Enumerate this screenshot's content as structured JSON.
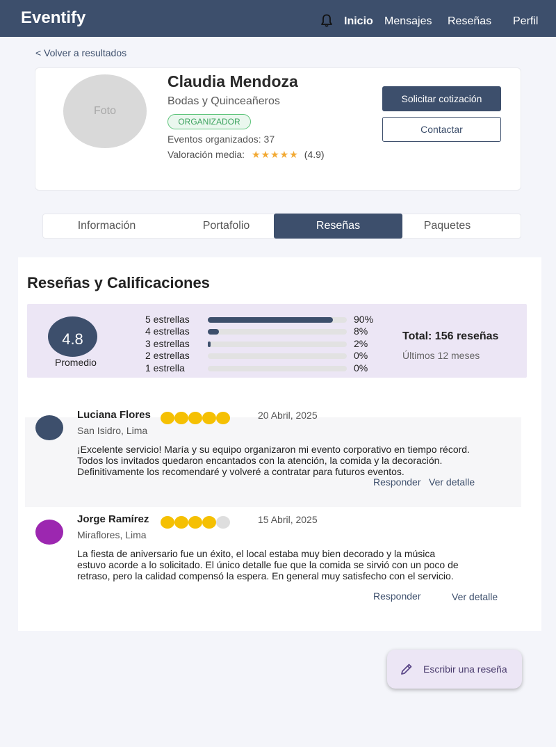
{
  "header": {
    "brand": "Eventify",
    "nav": [
      "Inicio",
      "Mensajes",
      "Reseñas",
      "Perfil"
    ]
  },
  "back_link": "< Volver a resultados",
  "profile": {
    "photo_placeholder": "Foto",
    "name": "Claudia Mendoza",
    "specialty": "Bodas y Quinceañeros",
    "badge": "ORGANIZADOR",
    "events": "Eventos organizados: 37",
    "rating_label": "Valoración media:",
    "rating_stars": "★★★★★",
    "rating_value": "(4.9)",
    "primary_button": "Solicitar cotización",
    "secondary_button": "Contactar"
  },
  "tabs": [
    "Información",
    "Portafolio",
    "Reseñas",
    "Paquetes"
  ],
  "active_tab": "Reseñas",
  "reviews_section": {
    "title": "Reseñas y Calificaciones",
    "average": "4.8",
    "average_label": "Promedio",
    "distribution": [
      {
        "label": "5 estrellas",
        "percent": 90,
        "percent_text": "90%"
      },
      {
        "label": "4 estrellas",
        "percent": 8,
        "percent_text": "8%"
      },
      {
        "label": "3 estrellas",
        "percent": 2,
        "percent_text": "2%"
      },
      {
        "label": "2 estrellas",
        "percent": 0,
        "percent_text": "0%"
      },
      {
        "label": "1 estrella",
        "percent": 0,
        "percent_text": "0%"
      }
    ],
    "total": "Total: 156 reseñas",
    "period": "Últimos 12 meses"
  },
  "reviews": [
    {
      "name": "Luciana Flores",
      "rating": 5,
      "date": "20 Abril, 2025",
      "location": "San Isidro, Lima",
      "avatar_color": "#3d4f6c",
      "text_lines": [
        "¡Excelente servicio! María y su equipo organizaron mi evento corporativo en tiempo récord.",
        "Todos los invitados quedaron encantados con la atención, la comida y la decoración.",
        "Definitivamente los recomendaré y volveré a contratar para futuros eventos."
      ],
      "reply": "Responder",
      "detail": "Ver detalle"
    },
    {
      "name": "Jorge Ramírez",
      "rating": 4,
      "date": "15 Abril, 2025",
      "location": "Miraflores, Lima",
      "avatar_color": "#9c27b0",
      "text_lines": [
        "La fiesta de aniversario fue un éxito, el local estaba muy bien decorado y la música",
        "estuvo acorde a lo solicitado. El único detalle fue que la comida se sirvió con un poco de",
        "retraso, pero la calidad compensó la espera. En general muy satisfecho con el servicio."
      ],
      "reply": "Responder",
      "detail": "Ver detalle"
    }
  ],
  "fab": {
    "label": "Escribir una reseña",
    "icon": "pencil-icon"
  },
  "colors": {
    "primary": "#3d4f6c",
    "star_gold": "#f5c003",
    "summary_bg": "#ece6f5",
    "badge_green": "#3da35f"
  }
}
